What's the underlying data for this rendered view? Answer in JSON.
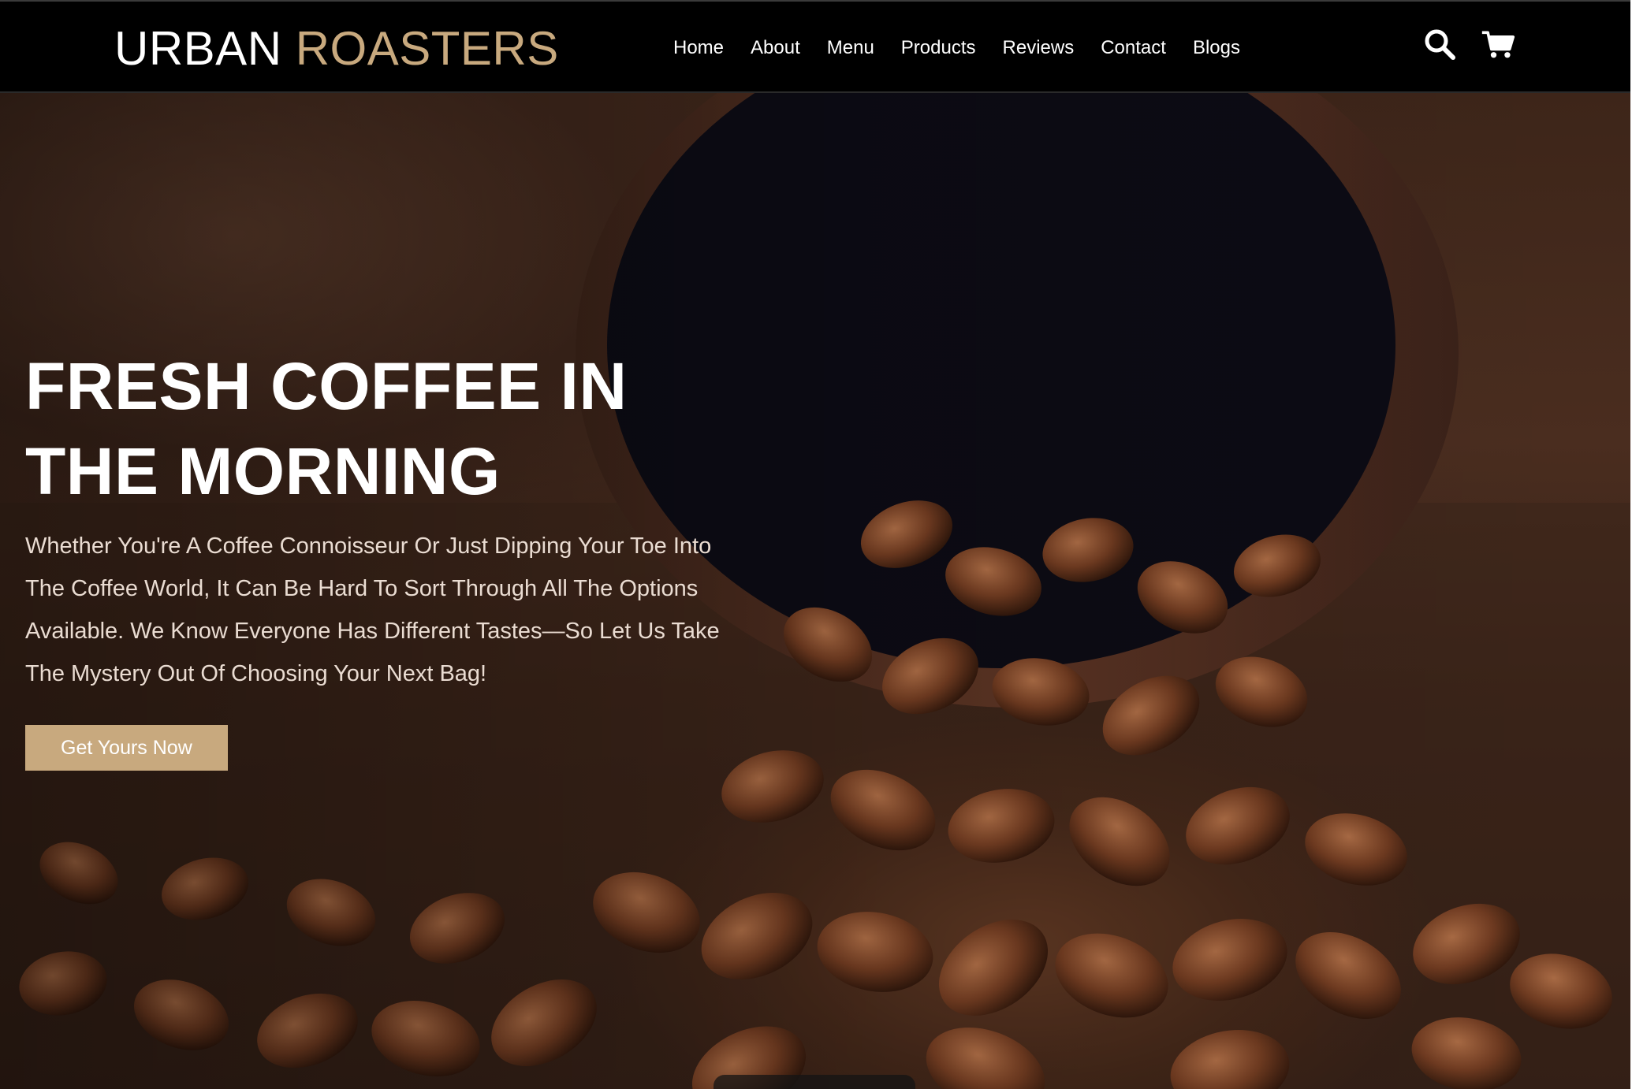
{
  "brand": {
    "word1": "URBAN",
    "word2": "ROASTERS",
    "accent_color": "#c8a97e"
  },
  "nav": {
    "items": [
      {
        "label": "Home"
      },
      {
        "label": "About"
      },
      {
        "label": "Menu"
      },
      {
        "label": "Products"
      },
      {
        "label": "Reviews"
      },
      {
        "label": "Contact"
      },
      {
        "label": "Blogs"
      }
    ]
  },
  "header_icons": {
    "search": "search-icon",
    "cart": "cart-icon"
  },
  "hero": {
    "title_line1": "FRESH COFFEE IN",
    "title_line2": "THE MORNING",
    "text": "Whether You're A Coffee Connoisseur Or Just Dipping Your Toe Into The Coffee World, It Can Be Hard To Sort Through All The Options Available. We Know Everyone Has Different Tastes—So Let Us Take The Mystery Out Of Choosing Your Next Bag!",
    "cta_label": "Get Yours Now",
    "background_image": "coffee beans spilling from a wooden bowl"
  },
  "colors": {
    "header_bg": "#000000",
    "button_bg": "#c8a97e",
    "hero_text": "#eadcd2"
  }
}
